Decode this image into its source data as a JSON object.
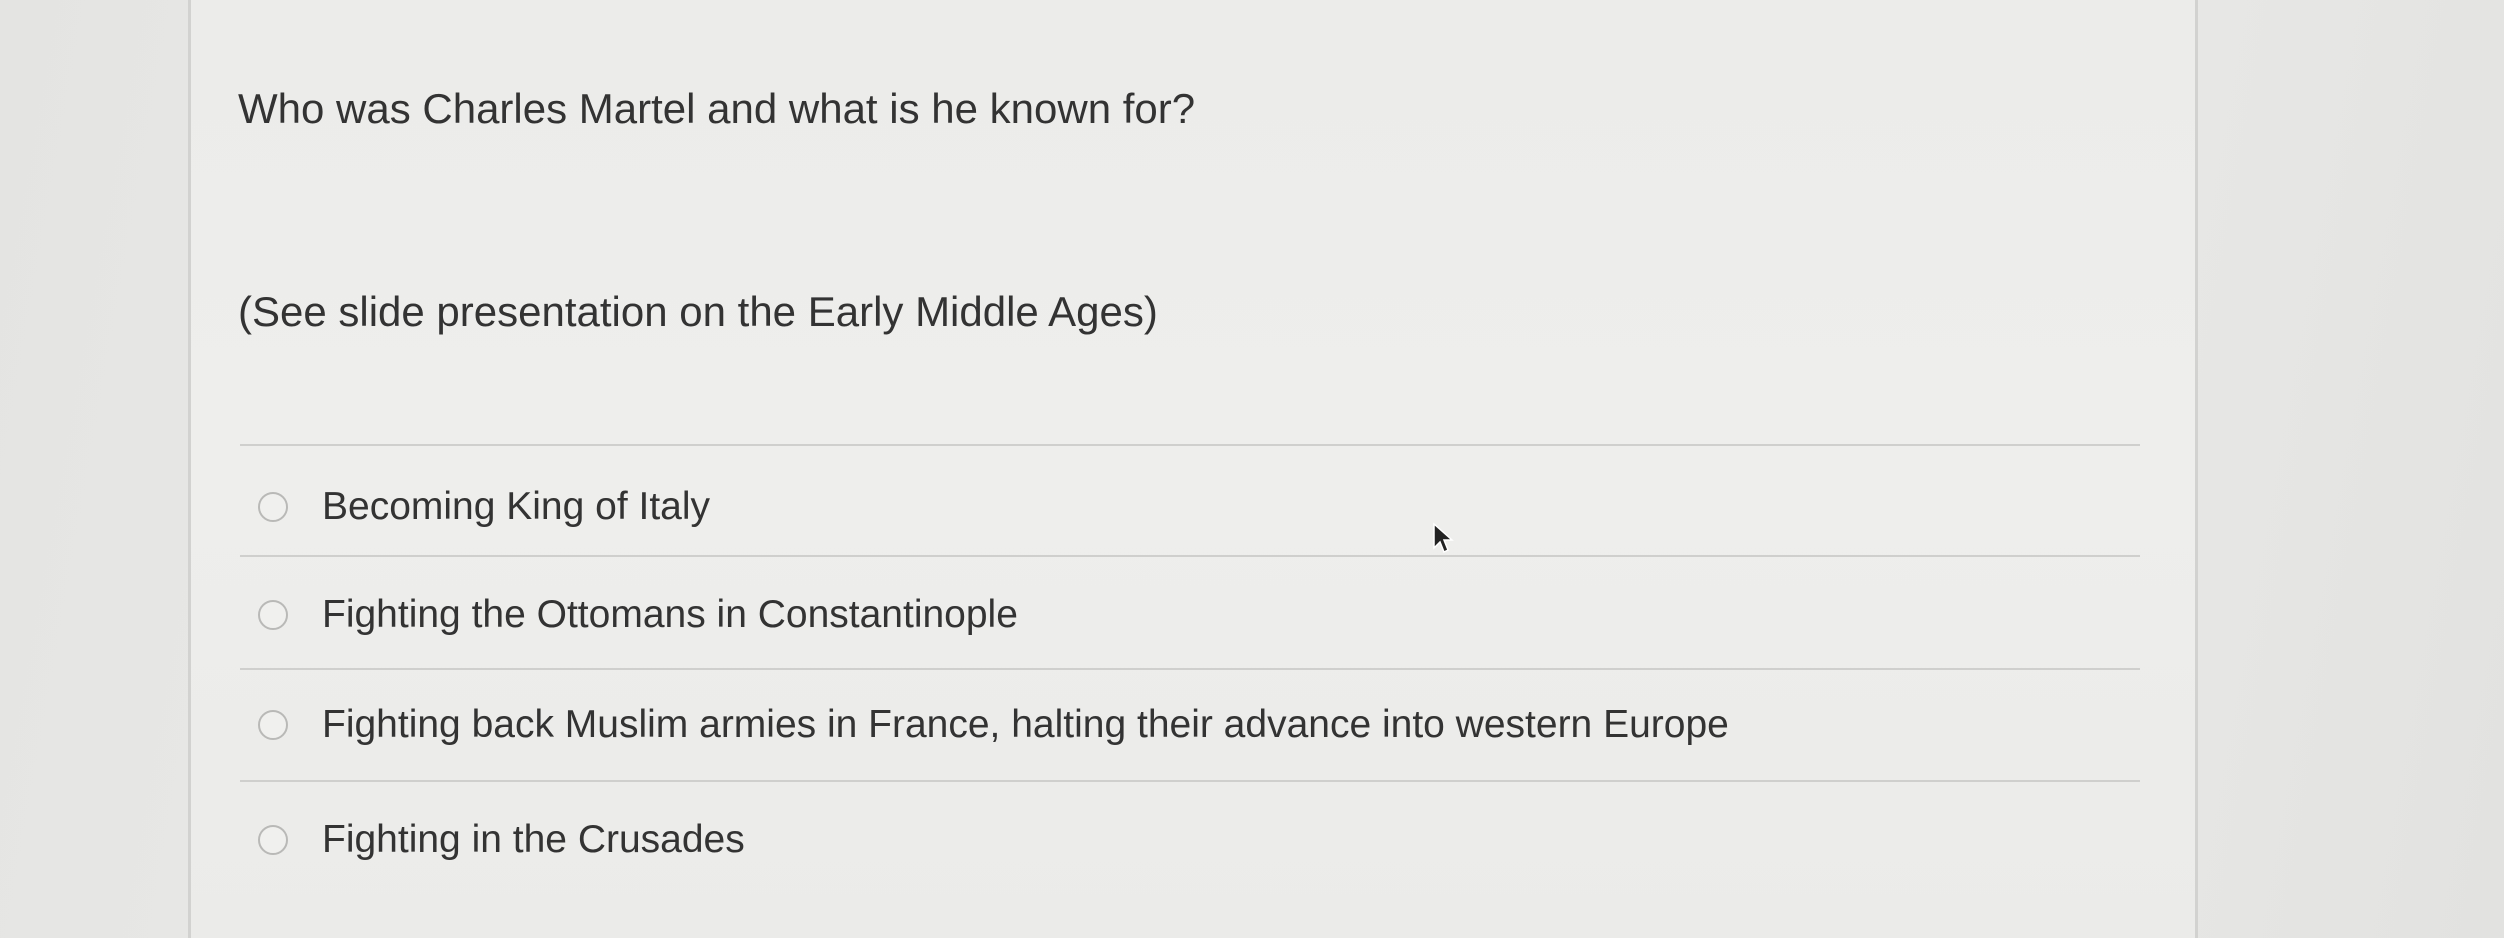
{
  "question": {
    "prompt": "Who was Charles Martel and what is he known for?",
    "note": "(See slide presentation on the Early Middle Ages)"
  },
  "answers": [
    {
      "label": "Becoming King of Italy",
      "selected": false
    },
    {
      "label": "Fighting the Ottomans in Constantinople",
      "selected": false
    },
    {
      "label": "Fighting back Muslim armies in France, halting their advance into western Europe",
      "selected": false
    },
    {
      "label": "Fighting in the Crusades",
      "selected": false
    }
  ],
  "colors": {
    "text": "#333333",
    "divider": "#cfcfcd",
    "radio_border": "#b9b9b7",
    "background": "#eeeeec"
  },
  "icons": {
    "pointer": "mouse-pointer-icon"
  }
}
